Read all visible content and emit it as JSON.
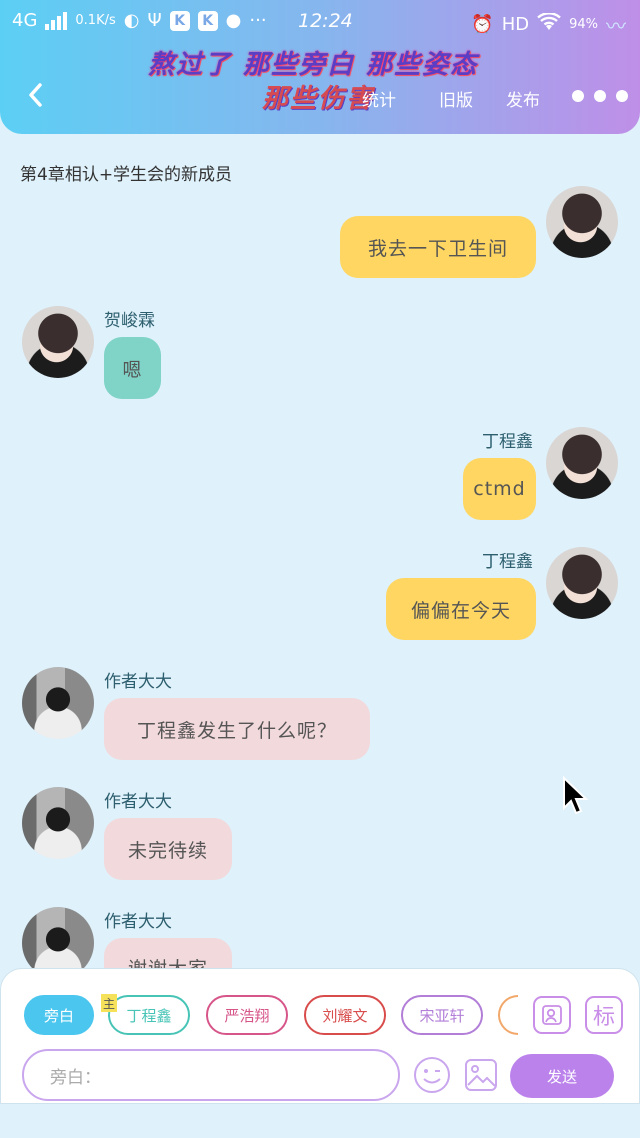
{
  "status_bar": {
    "network": "4G",
    "speed": "0.1K/s",
    "k1": "K",
    "k2": "K",
    "more": "···",
    "time": "12:24",
    "hd": "HD",
    "battery": "94%"
  },
  "header": {
    "banner_line1": "熬过了 那些旁白 那些姿态",
    "banner_line2": "那些伤害",
    "nav": [
      "统计",
      "旧版",
      "发布"
    ]
  },
  "chapter_title": "第4章相认+学生会的新成员",
  "messages": [
    {
      "side": "right",
      "name": "",
      "text": "我去一下卫生间",
      "color": "yellow"
    },
    {
      "side": "left",
      "name": "贺峻霖",
      "text": "嗯",
      "color": "teal"
    },
    {
      "side": "right",
      "name": "丁程鑫",
      "text": "ctmd",
      "color": "yellow"
    },
    {
      "side": "right",
      "name": "丁程鑫",
      "text": "偏偏在今天",
      "color": "yellow"
    },
    {
      "side": "left",
      "name": "作者大大",
      "text": "丁程鑫发生了什么呢？",
      "color": "pink"
    },
    {
      "side": "left",
      "name": "作者大大",
      "text": "未完待续",
      "color": "pink"
    },
    {
      "side": "left",
      "name": "作者大大",
      "text": "谢谢大家",
      "color": "pink"
    }
  ],
  "composer": {
    "characters": [
      {
        "label": "旁白",
        "color": "#4ac6ef"
      },
      {
        "label": "丁程鑫",
        "color": "#47c4b6"
      },
      {
        "label": "严浩翔",
        "color": "#d7568a"
      },
      {
        "label": "刘耀文",
        "color": "#d94c4c"
      },
      {
        "label": "宋亚轩",
        "color": "#b27ed8"
      }
    ],
    "main_tag": "主",
    "tag_icon": "标",
    "input_placeholder": "旁白：",
    "send_label": "发送"
  }
}
